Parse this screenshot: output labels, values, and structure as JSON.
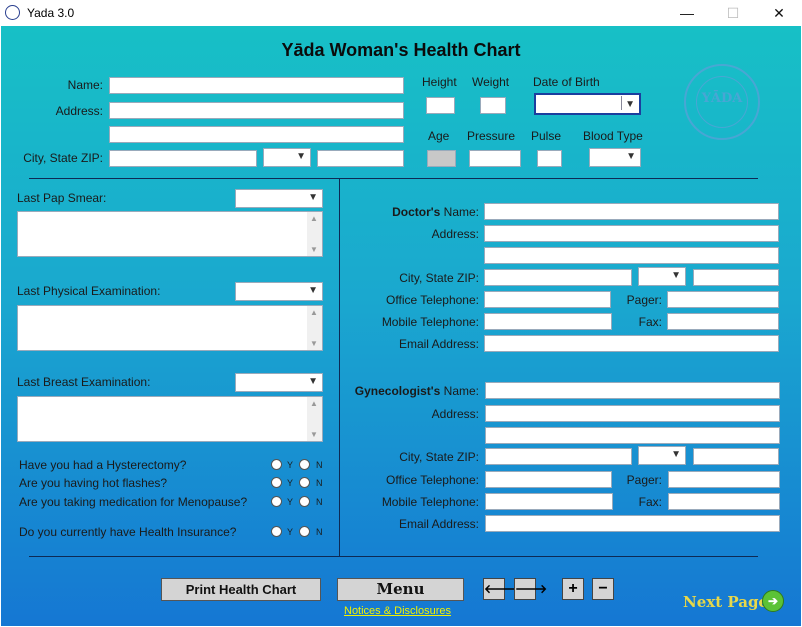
{
  "window": {
    "title": "Yada 3.0",
    "controls": {
      "minimize": "—",
      "maximize": "☐",
      "close": "✕"
    }
  },
  "form": {
    "title": "Yāda Woman's Health Chart",
    "patient": {
      "name_label": "Name:",
      "address_label": "Address:",
      "city_label": "City, State ZIP:",
      "height_label": "Height",
      "weight_label": "Weight",
      "dob_label": "Date of Birth",
      "age_label": "Age",
      "pressure_label": "Pressure",
      "pulse_label": "Pulse",
      "blood_type_label": "Blood Type"
    },
    "seal": {
      "text": "YĀDA",
      "ring_text": "Software Corporation"
    },
    "exams": {
      "pap_label": "Last Pap Smear:",
      "physical_label": "Last Physical Examination:",
      "breast_label": "Last Breast Examination:"
    },
    "questions": [
      {
        "text": "Have you had a Hysterectomy?",
        "yes": "Y",
        "no": "N"
      },
      {
        "text": "Are you having hot flashes?",
        "yes": "Y",
        "no": "N"
      },
      {
        "text": "Are you taking medication for Menopause?",
        "yes": "Y",
        "no": "N"
      },
      {
        "text": "Do you currently have Health Insurance?",
        "yes": "Y",
        "no": "N"
      }
    ],
    "doctor": {
      "title_bold": "Doctor's",
      "title_rest": " Name:",
      "address_label": "Address:",
      "city_label": "City, State ZIP:",
      "office_label": "Office Telephone:",
      "pager_label": "Pager:",
      "mobile_label": "Mobile Telephone:",
      "fax_label": "Fax:",
      "email_label": "Email Address:"
    },
    "gyn": {
      "title_bold": "Gynecologist's",
      "title_rest": " Name:",
      "address_label": "Address:",
      "city_label": "City, State ZIP:",
      "office_label": "Office Telephone:",
      "pager_label": "Pager:",
      "mobile_label": "Mobile Telephone:",
      "fax_label": "Fax:",
      "email_label": "Email Address:"
    }
  },
  "footer": {
    "print_label": "Print Health Chart",
    "menu_label": "Menu",
    "prev_glyph": "🡐",
    "next_glyph": "🡒",
    "add_glyph": "+",
    "remove_glyph": "−",
    "notices_label": "Notices & Disclosures",
    "next_page_label": "Next Page",
    "next_page_glyph": "➔"
  },
  "colors": {
    "gradient_top": "#17c0c6",
    "gradient_bottom": "#1577d3",
    "next_page": "#e8d84a",
    "link": "#f2f200"
  }
}
